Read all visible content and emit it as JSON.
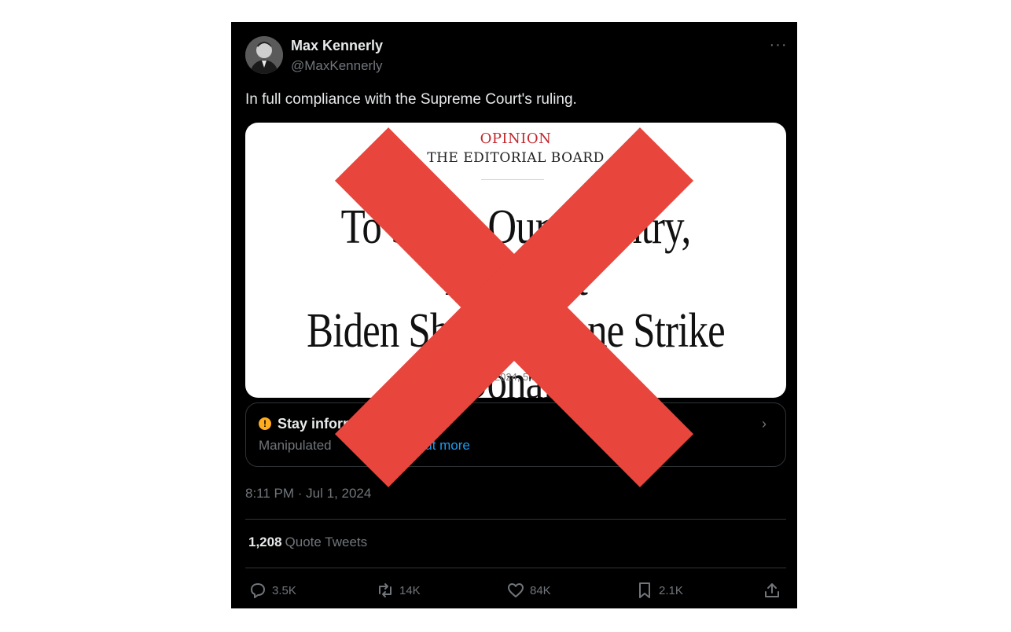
{
  "tweet": {
    "author_name": "Max Kennerly",
    "author_handle": "@MaxKennerly",
    "text": "In full compliance with the Supreme Court's ruling.",
    "timestamp": "8:11 PM · Jul 1, 2024",
    "more_icon": "more-icon"
  },
  "media": {
    "kicker": "OPINION",
    "board": "THE EDITORIAL BOARD",
    "headline_line1": "To Serve Our Country, President",
    "headline_line2": "Biden Should Drone Strike Donald",
    "dateline": "2024, 5:5"
  },
  "community_note": {
    "title": "Stay informed",
    "body": "Manipulated",
    "link": "Find out more",
    "icon": "alert-icon",
    "accent": "#ffad1f",
    "link_color": "#1d9bf0"
  },
  "stats": {
    "quote_count": "1,208",
    "quote_label": "Quote Tweets"
  },
  "actions": {
    "replies": "3.5K",
    "retweets": "14K",
    "likes": "84K",
    "bookmarks": "2.1K"
  },
  "overlay": {
    "x_color": "#e8453c"
  }
}
